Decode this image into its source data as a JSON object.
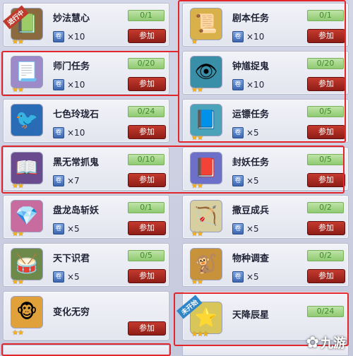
{
  "tasks": [
    {
      "name": "妙法慧心",
      "progress": "0/1",
      "reward_count": "×10",
      "button": "参加",
      "icon": "📗",
      "icon_bg": "#8a6a3e",
      "stars": "★★",
      "badge": "进行中"
    },
    {
      "name": "剧本任务",
      "progress": "0/1",
      "reward_count": "×10",
      "button": "参加",
      "icon": "📜",
      "icon_bg": "#d9b14a",
      "stars": "★",
      "badge": ""
    },
    {
      "name": "师门任务",
      "progress": "0/20",
      "reward_count": "×10",
      "button": "参加",
      "icon": "📃",
      "icon_bg": "#9d8ac9",
      "stars": "★★",
      "badge": ""
    },
    {
      "name": "钟馗捉鬼",
      "progress": "0/20",
      "reward_count": "×10",
      "button": "参加",
      "icon": "👁",
      "icon_bg": "#3a8fa8",
      "stars": "★★",
      "badge": ""
    },
    {
      "name": "七色玲珑石",
      "progress": "0/24",
      "reward_count": "×10",
      "button": "参加",
      "icon": "🐦",
      "icon_bg": "#2a6bb5",
      "stars": "",
      "badge": ""
    },
    {
      "name": "运镖任务",
      "progress": "0/5",
      "reward_count": "×5",
      "button": "参加",
      "icon": "📘",
      "icon_bg": "#4aa3b8",
      "stars": "★★",
      "badge": ""
    },
    {
      "name": "黑无常抓鬼",
      "progress": "0/10",
      "reward_count": "×7",
      "button": "参加",
      "icon": "📖",
      "icon_bg": "#6a4c8e",
      "stars": "★★",
      "badge": ""
    },
    {
      "name": "封妖任务",
      "progress": "0/5",
      "reward_count": "×5",
      "button": "参加",
      "icon": "📕",
      "icon_bg": "#6d70c9",
      "stars": "★★",
      "badge": ""
    },
    {
      "name": "盘龙岛斩妖",
      "progress": "0/1",
      "reward_count": "×5",
      "button": "参加",
      "icon": "💎",
      "icon_bg": "#c86b9e",
      "stars": "★★",
      "badge": ""
    },
    {
      "name": "撒豆成兵",
      "progress": "0/2",
      "reward_count": "×5",
      "button": "参加",
      "icon": "🏹",
      "icon_bg": "#d8cfa0",
      "stars": "★★",
      "badge": ""
    },
    {
      "name": "天下识君",
      "progress": "0/5",
      "reward_count": "×5",
      "button": "参加",
      "icon": "🥁",
      "icon_bg": "#6e8a4a",
      "stars": "★★",
      "badge": ""
    },
    {
      "name": "物种调查",
      "progress": "0/2",
      "reward_count": "×5",
      "button": "参加",
      "icon": "🐒",
      "icon_bg": "#c8923a",
      "stars": "★★",
      "badge": ""
    },
    {
      "name": "变化无穷",
      "progress": "",
      "reward_count": "",
      "button": "参加",
      "icon": "🐵",
      "icon_bg": "#e0a03a",
      "stars": "★★",
      "badge": ""
    },
    {
      "name": "天降辰星",
      "progress": "0/24",
      "reward_count": "",
      "button": "",
      "icon": "⭐",
      "icon_bg": "#d9c65a",
      "stars": "★★★",
      "badge": "未开始"
    }
  ],
  "colors": {
    "highlight": "#e2262b",
    "button": "#a8261c",
    "progress": "#8fca71",
    "badge_active": "#c0392b",
    "badge_pending": "#2f86c9"
  },
  "watermark": {
    "logo": "✿",
    "text": "九游"
  }
}
